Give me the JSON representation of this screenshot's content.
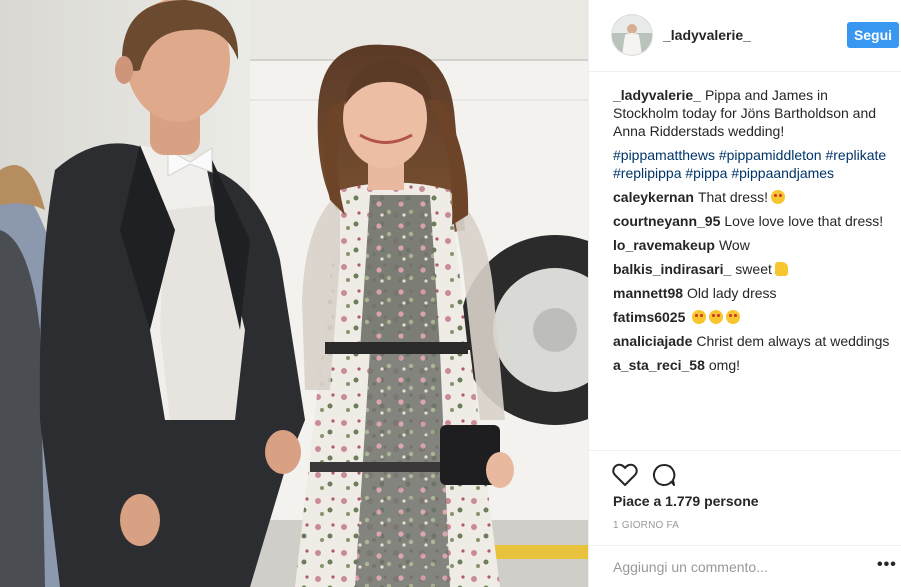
{
  "post": {
    "username": "_ladyvalerie_",
    "follow_label": "Segui",
    "caption": {
      "username": "_ladyvalerie_",
      "text": "Pippa and James in Stockholm today for Jöns Bartholdson and Anna Ridderstads wedding!",
      "hashtags": "#pippamatthews #pippamiddleton #replikate #replipippa #pippa #pippaandjames"
    },
    "comments": [
      {
        "user": "caleykernan",
        "text": "That dress!",
        "emoji": "heart-eyes"
      },
      {
        "user": "courtneyann_95",
        "text": "Love love love that dress!",
        "emoji": ""
      },
      {
        "user": "lo_ravemakeup",
        "text": "Wow",
        "emoji": ""
      },
      {
        "user": "balkis_indirasari_",
        "text": "sweet",
        "emoji": "thumbs"
      },
      {
        "user": "mannett98",
        "text": "Old lady dress",
        "emoji": ""
      },
      {
        "user": "fatims6025",
        "text": "",
        "emoji": "kiss"
      },
      {
        "user": "analiciajade",
        "text": "Christ dem always at weddings",
        "emoji": ""
      },
      {
        "user": "a_sta_reci_58",
        "text": "omg!",
        "emoji": ""
      }
    ],
    "likes_text": "Piace a 1.779 persone",
    "time_text": "1 GIORNO FA",
    "comment_placeholder": "Aggiungi un commento...",
    "more_label": "•••",
    "icons": {
      "like": "heart-icon",
      "comment": "comment-bubble-icon"
    }
  }
}
